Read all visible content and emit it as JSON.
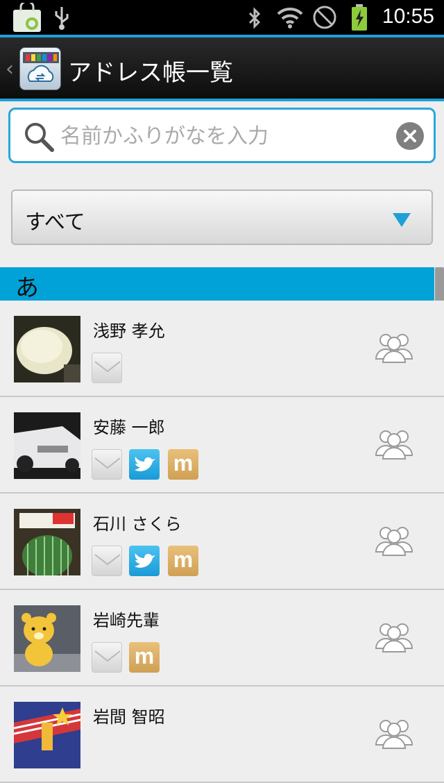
{
  "status_bar": {
    "time": "10:55",
    "icons": [
      "shopping-bag-icon",
      "usb-icon",
      "bluetooth-icon",
      "wifi-icon",
      "do-not-disturb-icon",
      "battery-charging-icon"
    ]
  },
  "header": {
    "title": "アドレス帳一覧"
  },
  "search": {
    "placeholder": "名前かふりがなを入力",
    "value": ""
  },
  "filter": {
    "selected": "すべて"
  },
  "section": {
    "label": "あ"
  },
  "contacts": [
    {
      "name": "浅野 孝允",
      "services": [
        "mail"
      ]
    },
    {
      "name": "安藤 一郎",
      "services": [
        "mail",
        "twitter",
        "mixi"
      ]
    },
    {
      "name": "石川 さくら",
      "services": [
        "mail",
        "twitter",
        "mixi"
      ]
    },
    {
      "name": "岩崎先輩",
      "services": [
        "mail",
        "mixi"
      ]
    },
    {
      "name": "岩間 智昭",
      "services": []
    }
  ],
  "badge_labels": {
    "mixi": "m"
  },
  "colors": {
    "accent": "#00a2d8",
    "twitter": "#1a9ad8",
    "mixi": "#cfa055"
  }
}
